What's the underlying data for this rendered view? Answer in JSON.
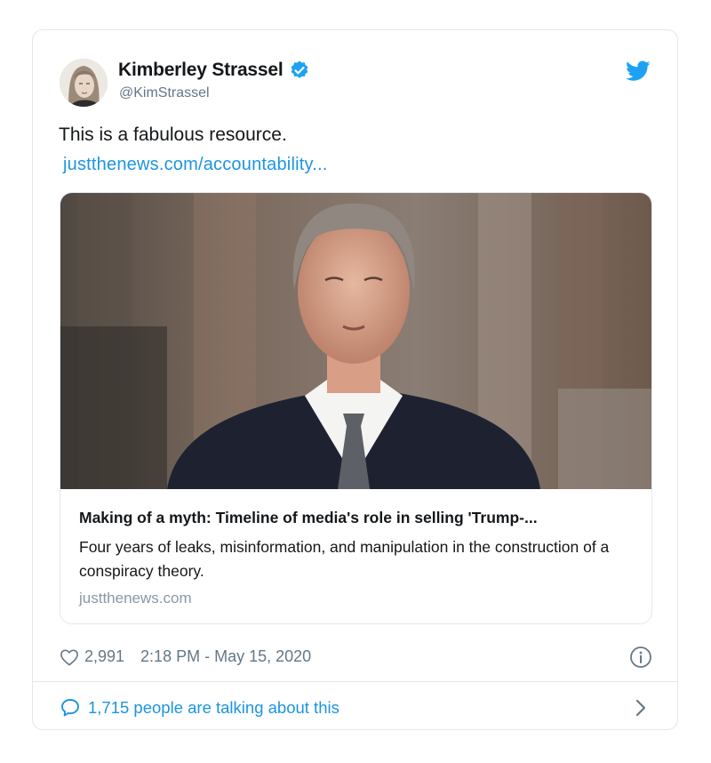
{
  "author": {
    "name": "Kimberley Strassel",
    "handle": "@KimStrassel"
  },
  "tweet": {
    "text": "This is a fabulous resource.",
    "link_text": "justthenews.com/accountability..."
  },
  "link_card": {
    "title": "Making of a myth: Timeline of media's role in selling 'Trump-...",
    "description": "Four years of leaks, misinformation, and manipulation in the construction of a conspiracy theory.",
    "domain": "justthenews.com"
  },
  "meta": {
    "likes": "2,991",
    "timestamp": "2:18 PM - May 15, 2020"
  },
  "footer": {
    "talking": "1,715 people are talking about this"
  },
  "icons": {
    "verified": "verified-badge-icon",
    "brand": "twitter-bird-icon",
    "like": "heart-icon",
    "info": "info-icon",
    "reply": "speech-bubble-icon",
    "more": "chevron-right-icon"
  },
  "colors": {
    "link": "#1b95e0",
    "secondary_text": "#657786",
    "border": "#e1e8ed",
    "primary_text": "#14171a"
  }
}
